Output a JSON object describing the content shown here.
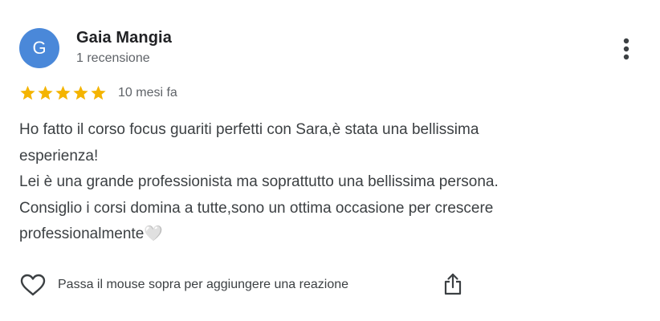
{
  "review": {
    "author": {
      "initial": "G",
      "name": "Gaia Mangia",
      "meta": "1 recensione",
      "avatar_color": "#4a88d9"
    },
    "rating": {
      "stars": 5,
      "max_stars": 5,
      "star_color": "#f4b400"
    },
    "date": "10 mesi fa",
    "text": "Ho fatto il corso focus guariti perfetti con Sara,è stata una bellissima\nesperienza!\nLei è una grande professionista ma soprattutto una bellissima persona.\nConsiglio i corsi domina a tutte,sono un ottima occasione per crescere\nprofessionalmente🤍",
    "reaction_hint": "Passa il mouse sopra per aggiungere una reazione"
  },
  "icons": {
    "more": "more-vertical-icon",
    "heart": "heart-outline-icon",
    "share": "share-icon",
    "star": "star-icon"
  }
}
